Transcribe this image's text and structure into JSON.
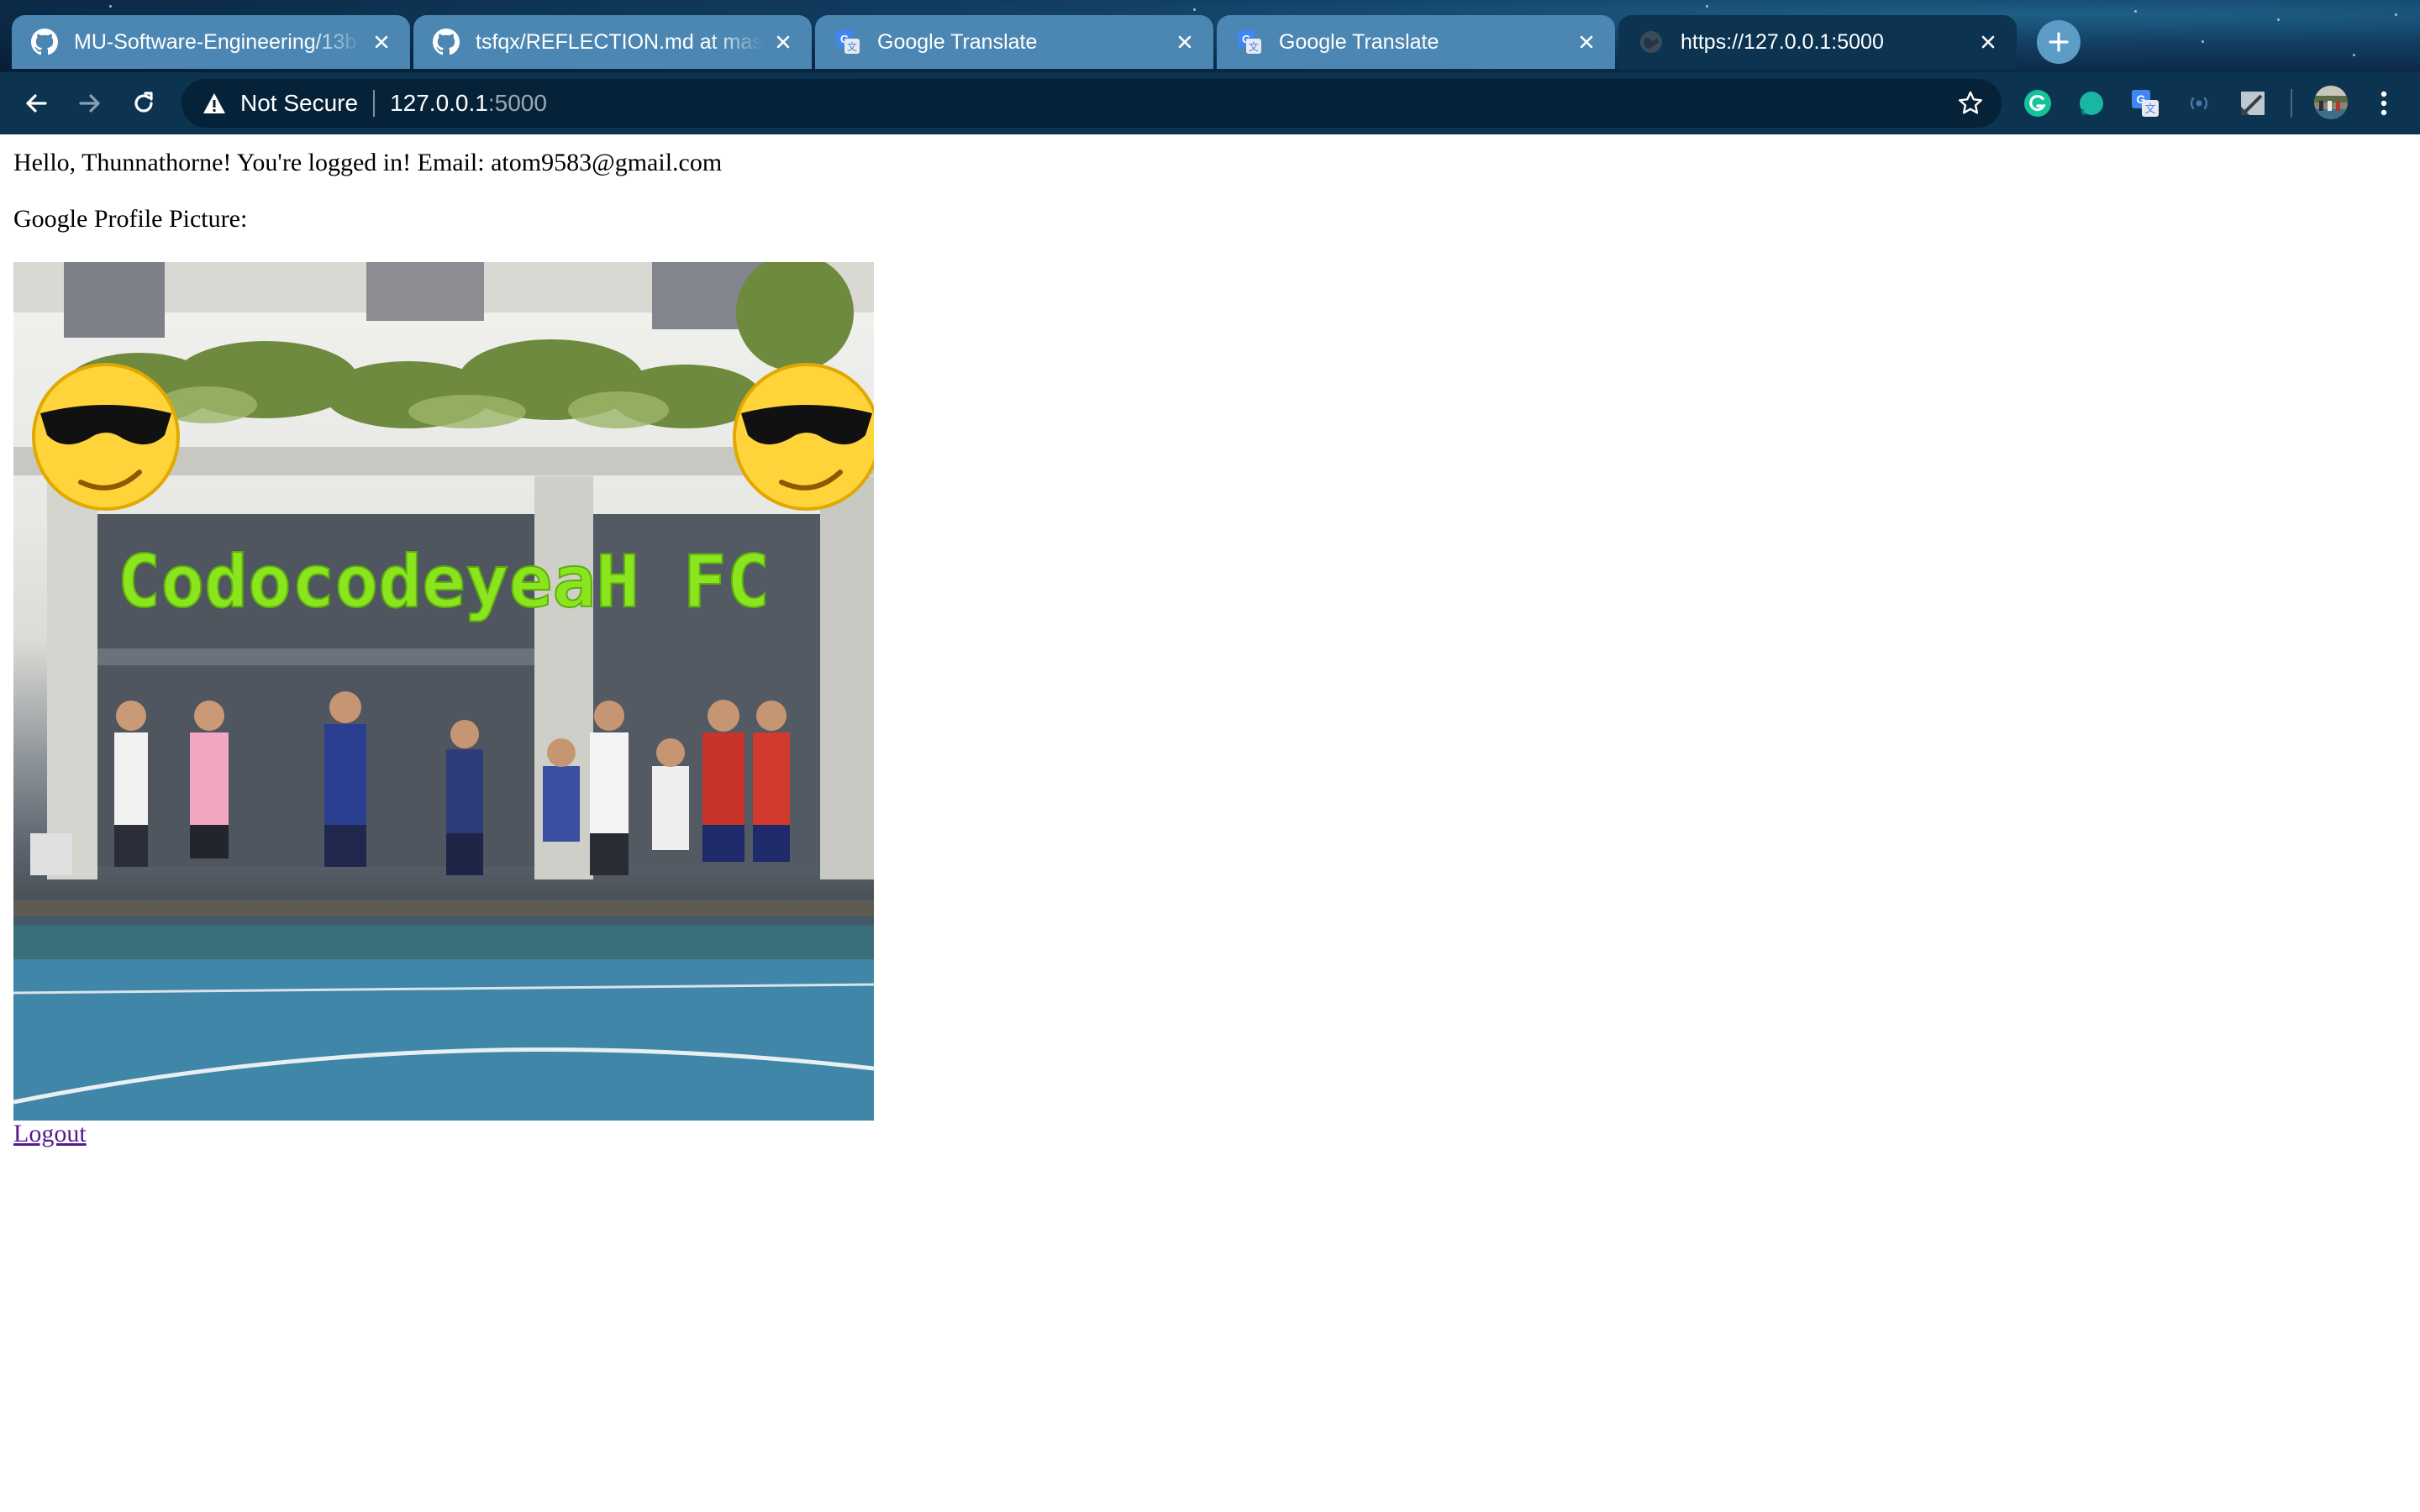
{
  "browser": {
    "tabs": [
      {
        "title": "MU-Software-Engineering/13b",
        "icon": "github-icon",
        "active": false
      },
      {
        "title": "tsfqx/REFLECTION.md at maste",
        "icon": "github-icon",
        "active": false
      },
      {
        "title": "Google Translate",
        "icon": "google-translate-icon",
        "active": false
      },
      {
        "title": "Google Translate",
        "icon": "google-translate-icon",
        "active": false
      },
      {
        "title": "https://127.0.0.1:5000",
        "icon": "globe-icon",
        "active": true
      }
    ],
    "address_bar": {
      "security_label": "Not Secure",
      "host": "127.0.0.1",
      "port": ":5000"
    },
    "extensions": [
      "grammarly-icon",
      "teal-circle-extension-icon",
      "google-translate-extension-icon",
      "extension-icon",
      "edit-extension-icon",
      "profile-avatar"
    ],
    "colors": {
      "tab_inactive": "#4b87b2",
      "tab_active": "#0c3350",
      "toolbar": "#0c3350",
      "omnibox": "#062238"
    }
  },
  "page": {
    "greeting": "Hello, Thunnathorne! You're logged in! Email: atom9583@gmail.com",
    "picture_label": "Google Profile Picture:",
    "picture_caption": "CodocodeyeaH FC",
    "logout_label": "Logout",
    "link_color": "#551a8b"
  }
}
